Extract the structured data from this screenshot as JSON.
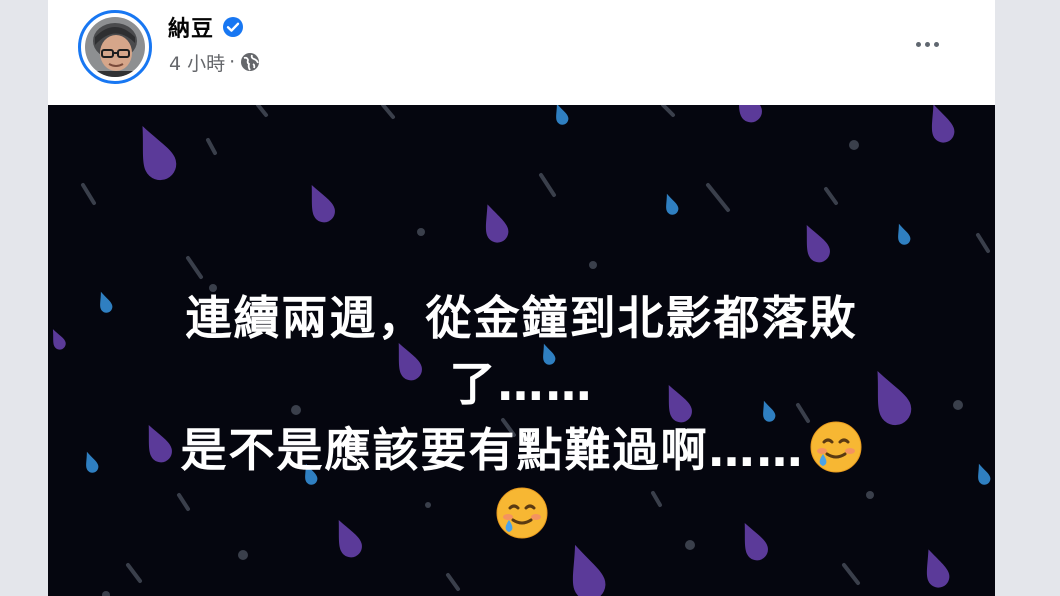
{
  "post": {
    "author": "納豆",
    "time": "4 小時",
    "separator": "·",
    "visibility_icon": "globe-icon",
    "verified_icon": "verified-badge-icon",
    "menu_icon": "more-horizontal-icon",
    "text_lines": [
      "連續兩週，從金鐘到北影都落敗",
      "了……",
      "是不是應該要有點難過啊……"
    ],
    "emoji": "smiling-face-with-tear-icon",
    "colors": {
      "accent": "#1877f2",
      "background": "#05060f",
      "drop_purple": "#5b3a99",
      "drop_blue": "#2f7fc1",
      "drop_gray": "#3a3f4b"
    }
  }
}
